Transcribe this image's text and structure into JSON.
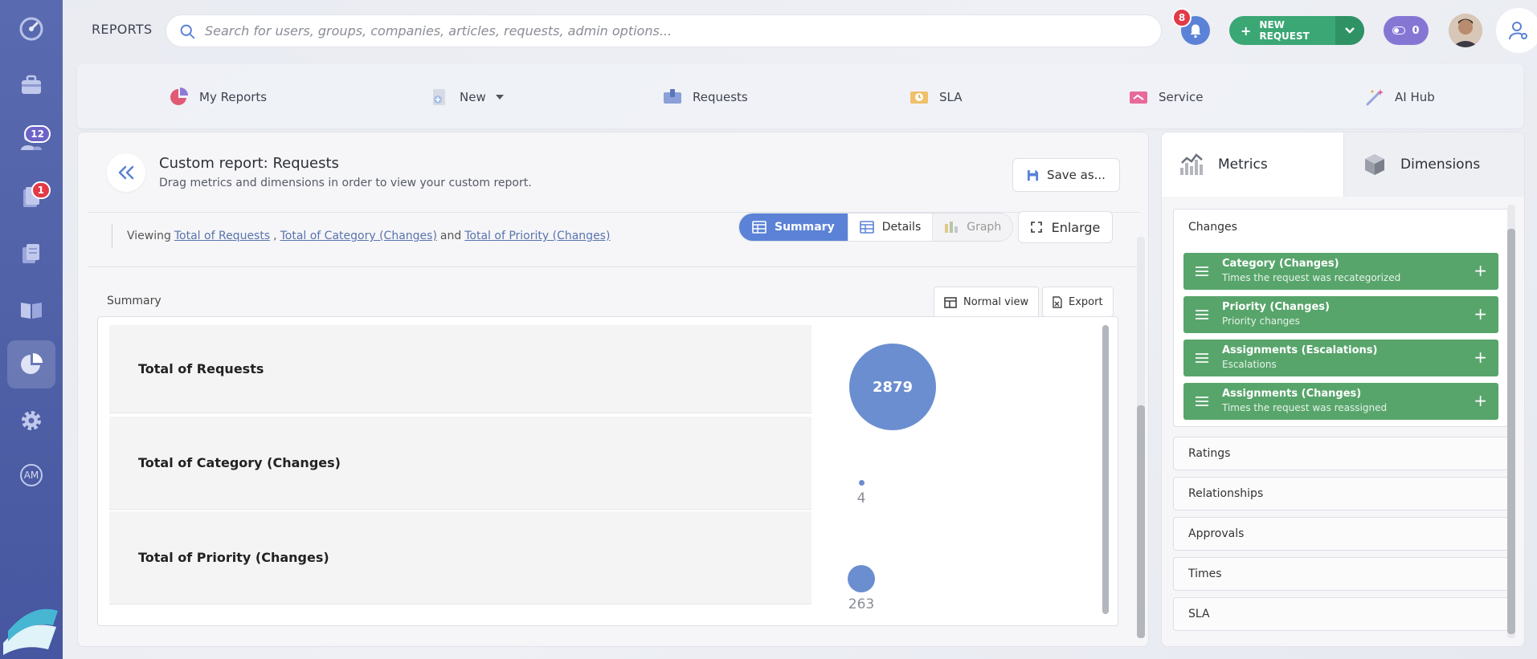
{
  "rail": {
    "badges": {
      "users": "12",
      "requests": "1"
    },
    "avatar_label": "AM"
  },
  "topbar": {
    "title": "REPORTS",
    "search_placeholder": "Search for users, groups, companies, articles, requests, admin options...",
    "notifications_count": "8",
    "new_request_label": "NEW REQUEST",
    "toggle_count": "0"
  },
  "nav": {
    "items": [
      {
        "label": "My Reports"
      },
      {
        "label": "New"
      },
      {
        "label": "Requests"
      },
      {
        "label": "SLA"
      },
      {
        "label": "Service"
      },
      {
        "label": "AI Hub"
      }
    ]
  },
  "report": {
    "title": "Custom report: Requests",
    "subtitle": "Drag metrics and dimensions in order to view your custom report.",
    "save_label": "Save as...",
    "viewing_prefix": "Viewing",
    "viewing_links": [
      "Total of Requests",
      "Total of Category (Changes)",
      "Total of Priority (Changes)"
    ],
    "viewing_sep1": ",",
    "viewing_and": "and",
    "modes": [
      "Summary",
      "Details",
      "Graph"
    ],
    "enlarge_label": "Enlarge",
    "summary_label": "Summary",
    "normal_view_label": "Normal view",
    "export_label": "Export",
    "rows": [
      {
        "label": "Total of Requests",
        "value": "2879"
      },
      {
        "label": "Total of Category (Changes)",
        "value": "4"
      },
      {
        "label": "Total of Priority (Changes)",
        "value": "263"
      }
    ]
  },
  "right": {
    "tabs": [
      "Metrics",
      "Dimensions"
    ],
    "open_group": "Changes",
    "metrics": [
      {
        "title": "Category (Changes)",
        "sub": "Times the request was recategorized"
      },
      {
        "title": "Priority (Changes)",
        "sub": "Priority changes"
      },
      {
        "title": "Assignments (Escalations)",
        "sub": "Escalations"
      },
      {
        "title": "Assignments (Changes)",
        "sub": "Times the request was reassigned"
      }
    ],
    "groups": [
      "Ratings",
      "Relationships",
      "Approvals",
      "Times",
      "SLA"
    ]
  },
  "colors": {
    "rail": "#4e5fa6",
    "accent_blue": "#5b82d6",
    "green": "#3aa774",
    "metric_green": "#58a56b",
    "bubble": "#6b8ed0"
  }
}
